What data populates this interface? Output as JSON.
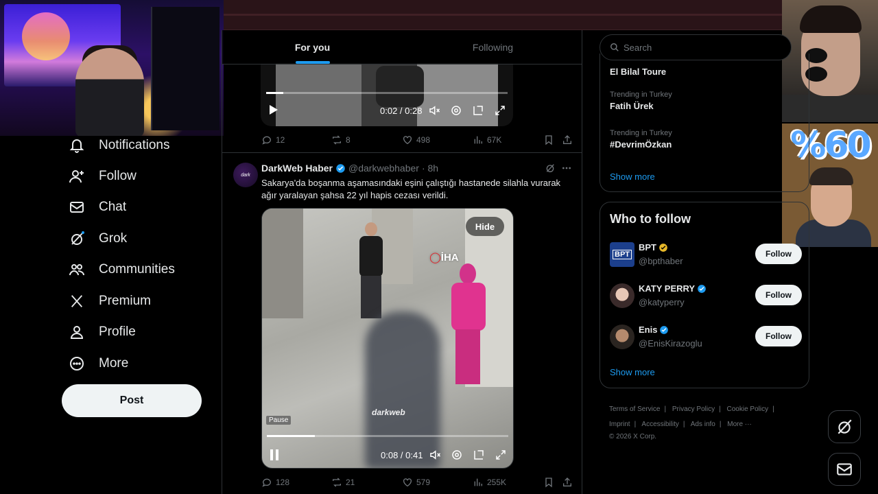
{
  "sidebar": {
    "items": [
      {
        "label": "Notifications",
        "icon": "bell-icon"
      },
      {
        "label": "Follow",
        "icon": "person-plus-icon"
      },
      {
        "label": "Chat",
        "icon": "mail-icon"
      },
      {
        "label": "Grok",
        "icon": "grok-icon"
      },
      {
        "label": "Communities",
        "icon": "communities-icon"
      },
      {
        "label": "Premium",
        "icon": "x-logo-icon"
      },
      {
        "label": "Profile",
        "icon": "person-icon"
      },
      {
        "label": "More",
        "icon": "more-circle-icon"
      }
    ],
    "post_label": "Post"
  },
  "feed": {
    "tabs": [
      {
        "label": "For you",
        "active": true
      },
      {
        "label": "Following",
        "active": false
      }
    ],
    "tweet1": {
      "video": {
        "time": "0:02 / 0:28",
        "progress": 0.07
      },
      "replies": "12",
      "reposts": "8",
      "likes": "498",
      "views": "67K"
    },
    "tweet2": {
      "name": "DarkWeb Haber",
      "handle": "@darkwebhaber",
      "time": "· 8h",
      "text": "Sakarya'da boşanma aşamasındaki eşini çalıştığı hastanede silahla vurarak ağır yaralayan şahsa 22 yıl hapis cezası verildi.",
      "avatar_text": "dark",
      "video": {
        "hide_label": "Hide",
        "pause_tooltip": "Pause",
        "watermark_iha": "İHA",
        "watermark_dark": "darkweb",
        "time": "0:08 / 0:41",
        "progress": 0.2
      },
      "replies": "128",
      "reposts": "21",
      "likes": "579",
      "views": "255K"
    }
  },
  "right": {
    "search_placeholder": "Search",
    "trends": [
      {
        "context": "",
        "title": "El Bilal Toure"
      },
      {
        "context": "Trending in Turkey",
        "title": "Fatih Ürek"
      },
      {
        "context": "Trending in Turkey",
        "title": "#DevrimÖzkan"
      }
    ],
    "trends_show_more": "Show more",
    "who_to_follow": {
      "title": "Who to follow",
      "accounts": [
        {
          "name": "BPT",
          "handle": "@bpthaber",
          "badge": "gold",
          "button": "Follow"
        },
        {
          "name": "KATY PERRY",
          "handle": "@katyperry",
          "badge": "blue",
          "button": "Follow"
        },
        {
          "name": "Enis",
          "handle": "@EnisKirazoglu",
          "badge": "blue",
          "button": "Follow"
        }
      ],
      "show_more": "Show more"
    },
    "footer": {
      "row1": [
        "Terms of Service",
        "Privacy Policy",
        "Cookie Policy"
      ],
      "row2": [
        "Imprint",
        "Accessibility",
        "Ads info",
        "More ···"
      ],
      "copyright": "© 2026 X Corp."
    }
  },
  "overlay": {
    "percent_text": "%60"
  },
  "colors": {
    "accent": "#1d9bf0",
    "verified_gold": "#e8b829",
    "verified_blue": "#1d9bf0",
    "text_primary": "#e7e9ea",
    "text_secondary": "#71767b",
    "border": "#2f3336"
  }
}
